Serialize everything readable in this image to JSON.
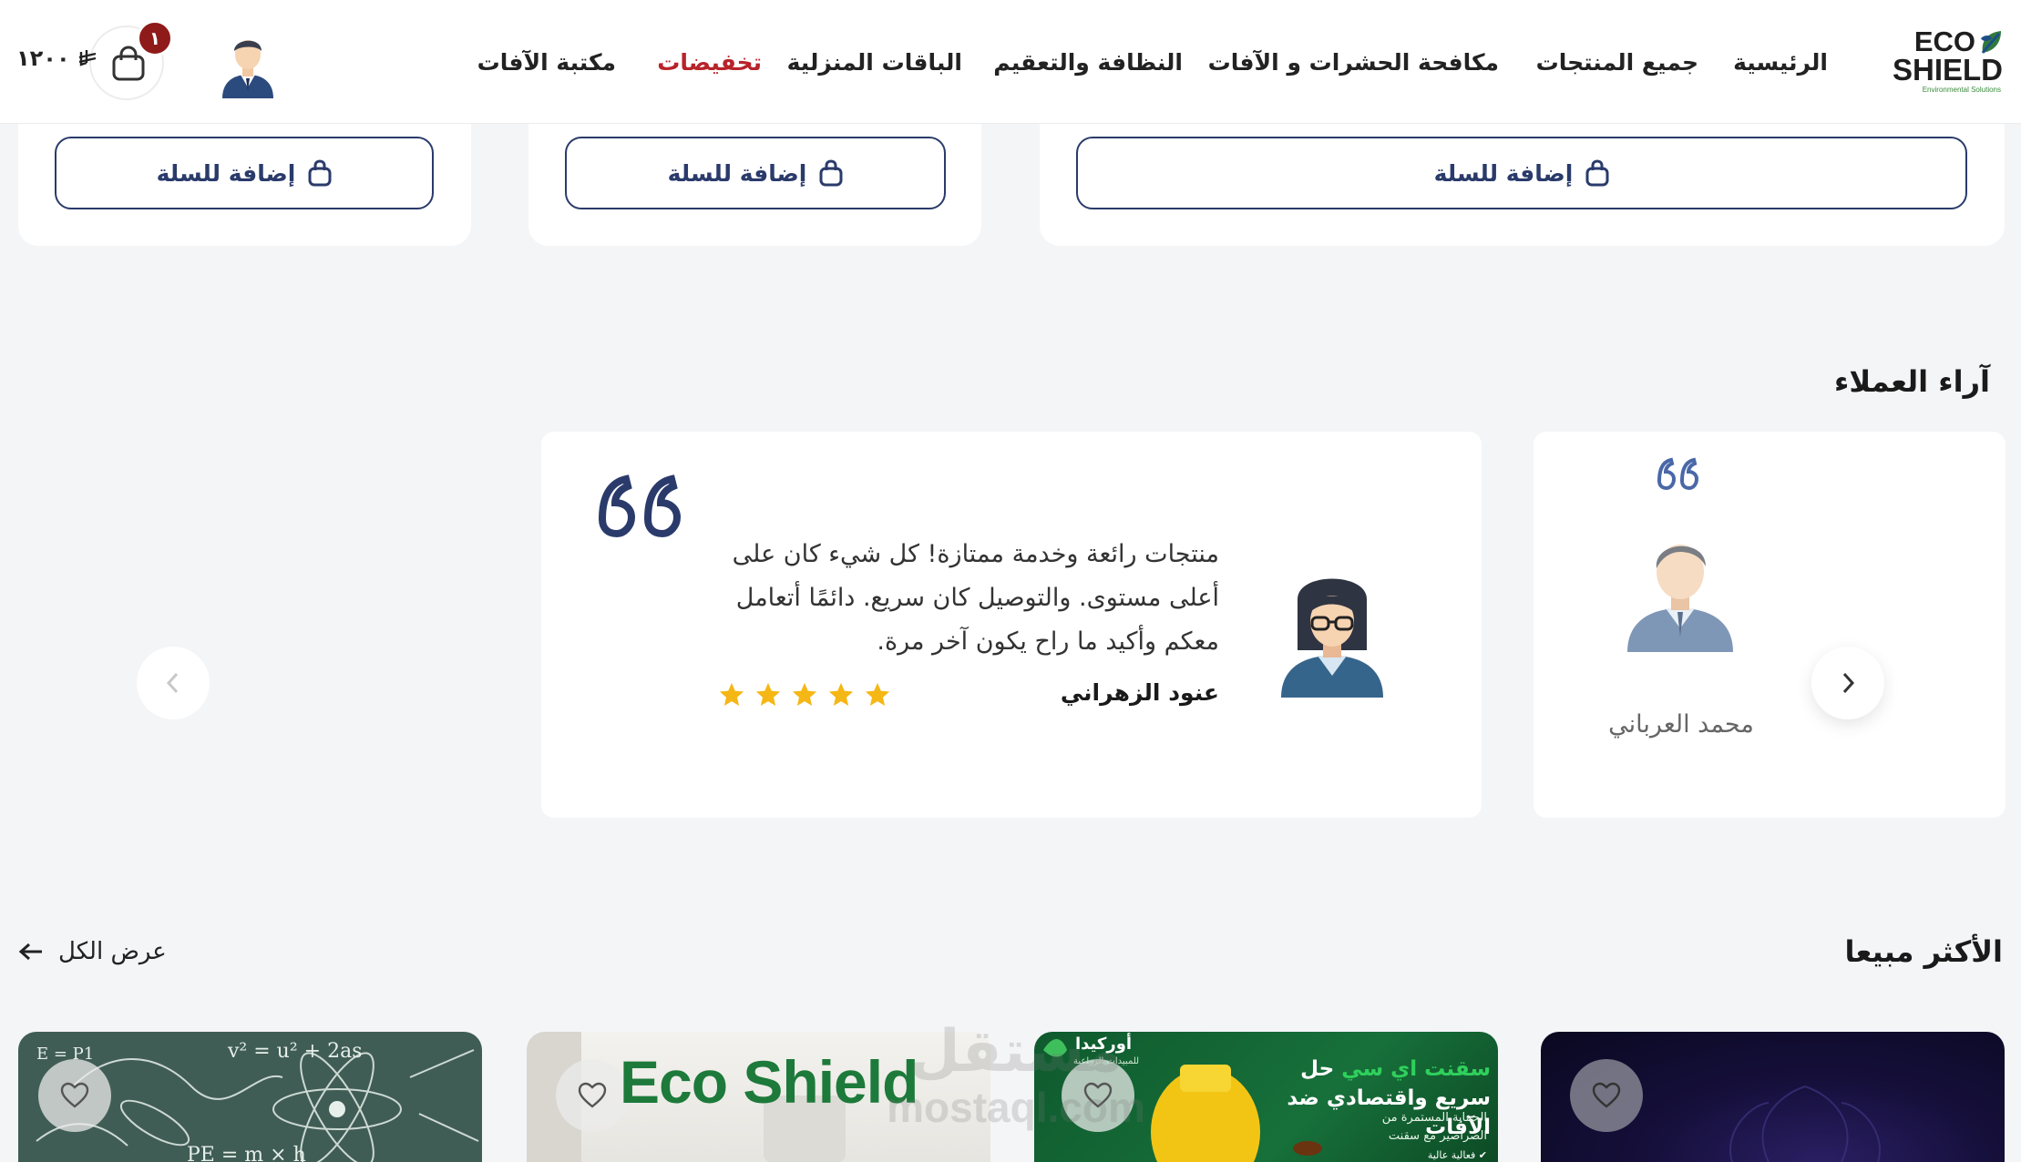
{
  "header": {
    "logo": {
      "line1": "ECO",
      "line2": "SHIELD",
      "tagline": "Environmental Solutions"
    },
    "nav": [
      {
        "label": "الرئيسية"
      },
      {
        "label": "جميع المنتجات"
      },
      {
        "label": "مكافحة الحشرات و الآفات"
      },
      {
        "label": "النظافة والتعقيم"
      },
      {
        "label": "الباقات المنزلية"
      },
      {
        "label": "تخفيضات"
      },
      {
        "label": "مكتبة الآفات"
      }
    ],
    "cart": {
      "count": "١",
      "total": "١٢٠٠",
      "currency_icon": "riyal-icon"
    }
  },
  "products_top": {
    "add_to_cart_label": "إضافة للسلة"
  },
  "testimonials": {
    "title": "آراء العملاء",
    "active": {
      "text": "منتجات رائعة وخدمة ممتازة! كل شيء كان على أعلى مستوى. والتوصيل كان سريع. دائمًا أتعامل معكم وأكيد ما راح يكون آخر مرة.",
      "name": "عنود الزهراني",
      "rating": 5
    },
    "side": {
      "name": "محمد العرباني"
    }
  },
  "best_sellers": {
    "title": "الأكثر مبيعا",
    "view_all": "عرض الكل",
    "ad": {
      "brand": "أوركيدا",
      "brand_sub": "للمبيدات الزراعية",
      "title_green": "سقنت اي سي",
      "title_rest": "حل سريع واقتصادي ضد الآفات",
      "subtitle": "الحماية المستمرة من الصراصير مع سقنت",
      "tag": "✔ فعالية عالية"
    },
    "eco_banner": "Eco Shield",
    "physics_formula": "v² = u² + 2as",
    "physics_formula2": "PE = m × h",
    "physics_formula3": "E = P1"
  },
  "watermark": {
    "line1": "مستقل",
    "line2": "mostaql.com"
  },
  "colors": {
    "brand_navy": "#2a3b6b",
    "accent_red": "#b8232a",
    "star": "#f5b715",
    "eco_green": "#1d7a3a"
  }
}
